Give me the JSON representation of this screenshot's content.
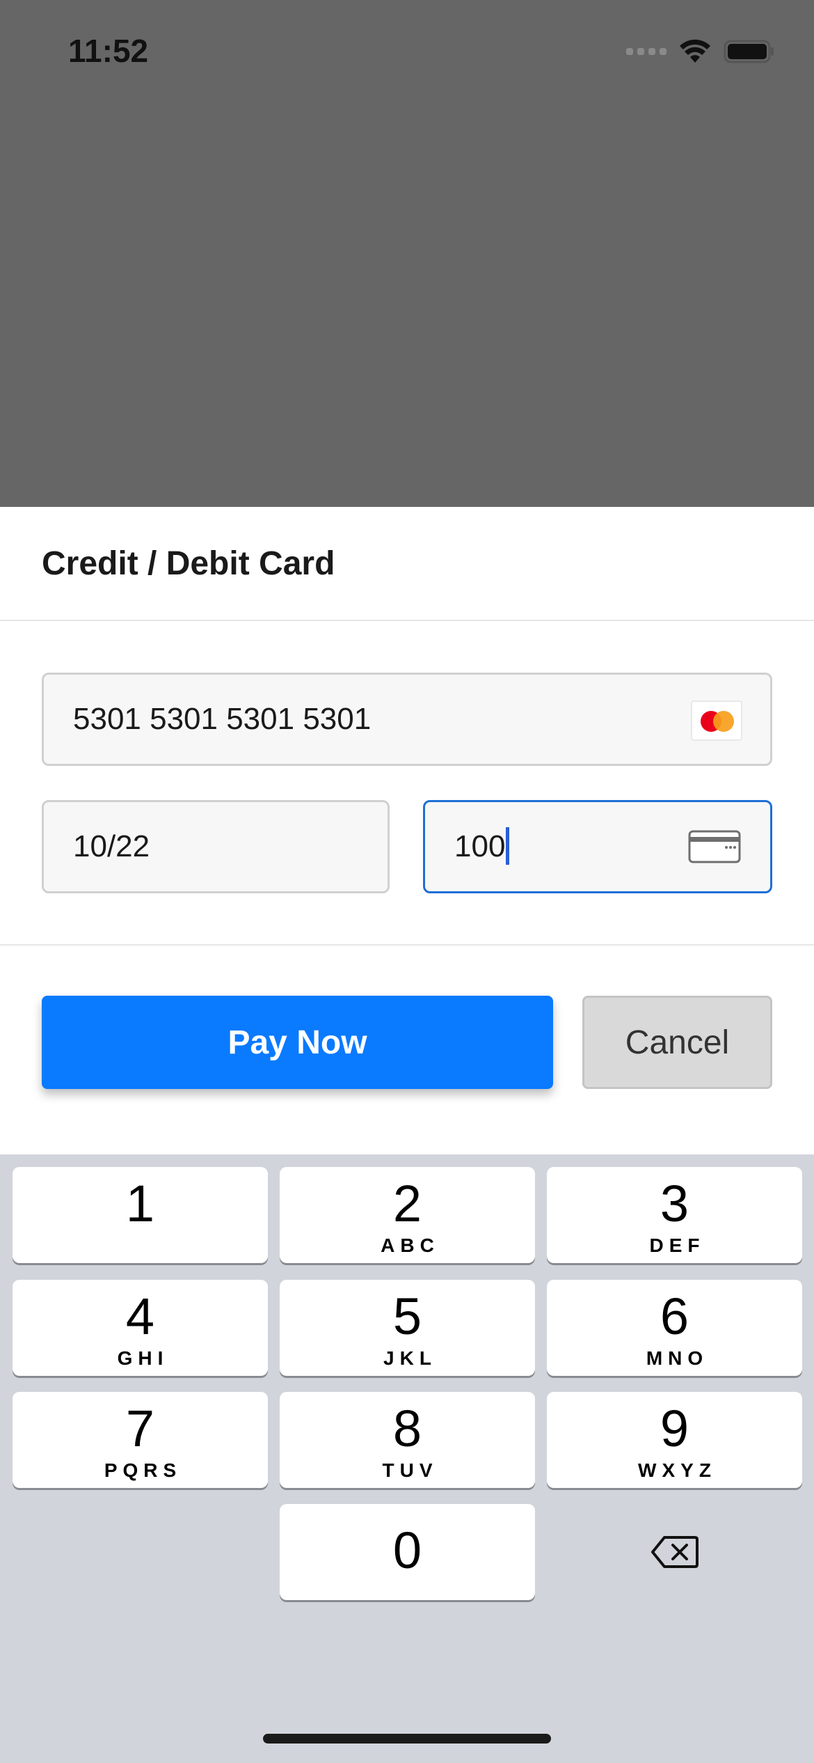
{
  "status_bar": {
    "time": "11:52"
  },
  "sheet": {
    "title": "Credit / Debit Card"
  },
  "card_form": {
    "card_number": "5301 5301 5301 5301",
    "card_brand_icon": "mastercard-icon",
    "expiry": "10/22",
    "cvc": "100",
    "cvc_icon": "card-back-cvc-icon"
  },
  "actions": {
    "pay_label": "Pay Now",
    "cancel_label": "Cancel",
    "pay_color": "#0A7AFF"
  },
  "keypad": {
    "keys": [
      {
        "num": "1",
        "letters": ""
      },
      {
        "num": "2",
        "letters": "ABC"
      },
      {
        "num": "3",
        "letters": "DEF"
      },
      {
        "num": "4",
        "letters": "GHI"
      },
      {
        "num": "5",
        "letters": "JKL"
      },
      {
        "num": "6",
        "letters": "MNO"
      },
      {
        "num": "7",
        "letters": "PQRS"
      },
      {
        "num": "8",
        "letters": "TUV"
      },
      {
        "num": "9",
        "letters": "WXYZ"
      },
      {
        "num": "0",
        "letters": ""
      }
    ],
    "delete_icon": "backspace-icon"
  }
}
